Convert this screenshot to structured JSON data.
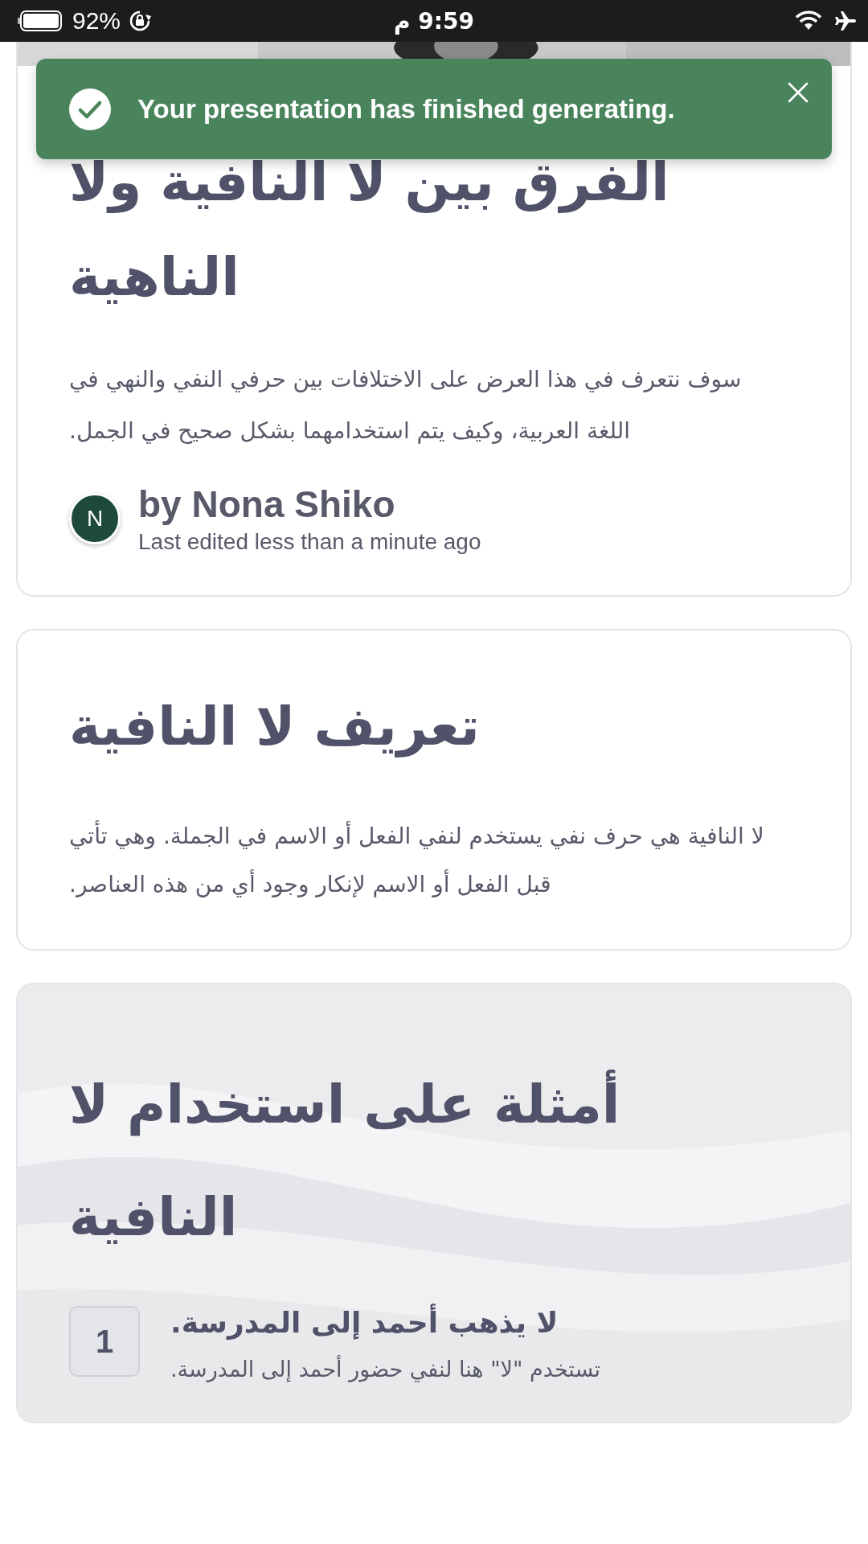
{
  "status_bar": {
    "battery": "92%",
    "time": "9:59 م"
  },
  "toast": {
    "message": "Your presentation has finished generating."
  },
  "cards": [
    {
      "kind": "cover",
      "title": "الفرق بين لا النافية ولا الناهية",
      "body": "سوف نتعرف في هذا العرض على الاختلافات بين حرفي النفي والنهي في اللغة العربية، وكيف يتم استخدامهما بشكل صحيح في الجمل.",
      "author": {
        "initial": "N",
        "name": "by Nona Shiko",
        "edited": "Last edited less than a minute ago"
      }
    },
    {
      "kind": "text",
      "title": "تعريف لا النافية",
      "body": "لا النافية هي حرف نفي يستخدم لنفي الفعل أو الاسم في الجملة. وهي تأتي قبل الفعل أو الاسم لإنكار وجود أي من هذه العناصر."
    },
    {
      "kind": "list",
      "title": "أمثلة على استخدام لا النافية",
      "items": [
        {
          "number": "1",
          "heading": "لا يذهب أحمد إلى المدرسة.",
          "text": "تستخدم \"لا\" هنا لنفي حضور أحمد إلى المدرسة."
        }
      ]
    }
  ]
}
